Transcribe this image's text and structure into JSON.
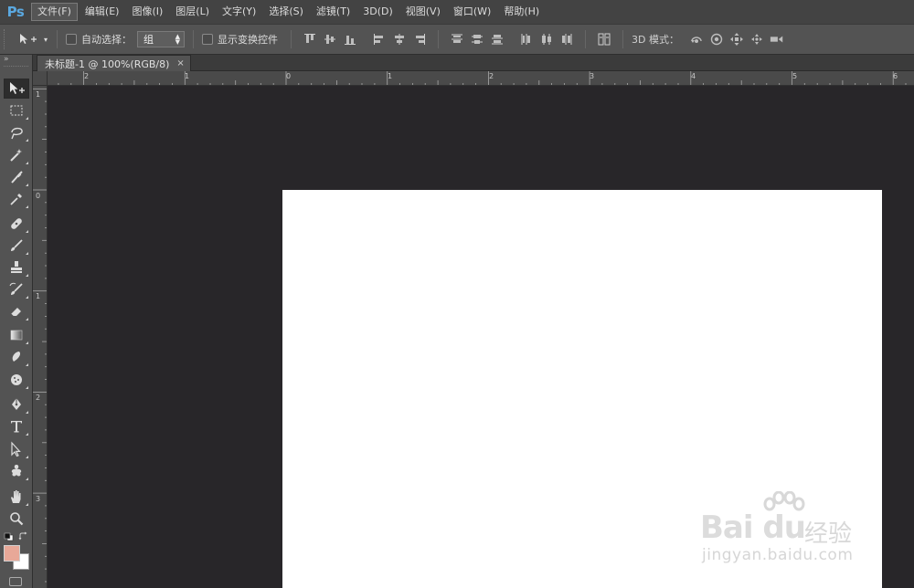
{
  "app": {
    "logo": "Ps"
  },
  "menu": [
    {
      "label": "文件(F)",
      "active": true
    },
    {
      "label": "编辑(E)"
    },
    {
      "label": "图像(I)"
    },
    {
      "label": "图层(L)"
    },
    {
      "label": "文字(Y)"
    },
    {
      "label": "选择(S)"
    },
    {
      "label": "滤镜(T)"
    },
    {
      "label": "3D(D)"
    },
    {
      "label": "视图(V)"
    },
    {
      "label": "窗口(W)"
    },
    {
      "label": "帮助(H)"
    }
  ],
  "options": {
    "auto_select_label": "自动选择：",
    "auto_select_value": "组",
    "show_transform_label": "显示变换控件",
    "mode_3d_label": "3D 模式："
  },
  "document": {
    "tab_title": "未标题-1 @ 100%(RGB/8)",
    "close_glyph": "×"
  },
  "ruler": {
    "h_labels": [
      "2",
      "1",
      "0",
      "1",
      "2",
      "3",
      "4",
      "5",
      "6"
    ],
    "v_labels": [
      "1",
      "0",
      "1",
      "2",
      "3"
    ]
  },
  "colors": {
    "foreground": "#e8a898",
    "background": "#ffffff"
  },
  "watermark": {
    "brand": "Bai du",
    "cn": "经验",
    "url": "jingyan.baidu.com"
  }
}
